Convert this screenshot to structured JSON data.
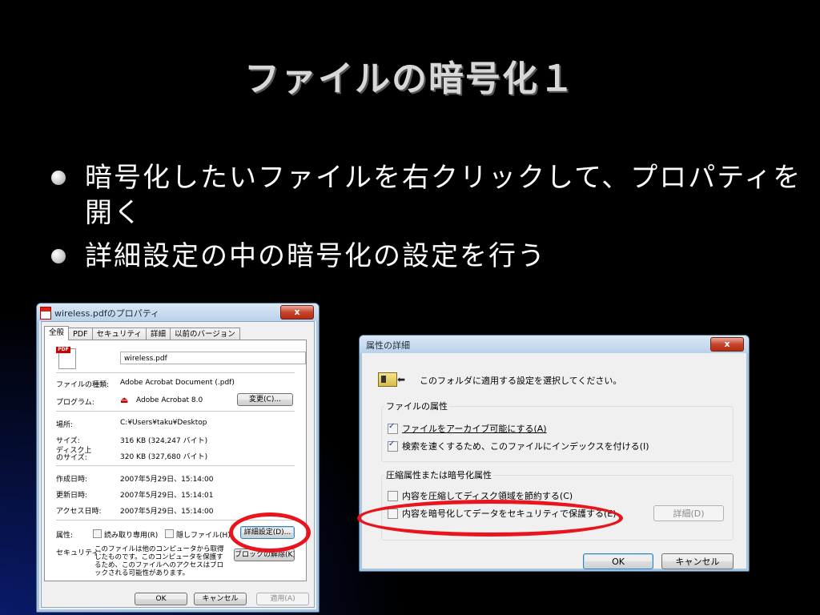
{
  "slide": {
    "title": "ファイルの暗号化１",
    "bullets": [
      "暗号化したいファイルを右クリックして、プロパティを開く",
      "詳細設定の中の暗号化の設定を行う"
    ]
  },
  "properties_window": {
    "title": "wireless.pdfのプロパティ",
    "close": "x",
    "tabs": [
      "全般",
      "PDF",
      "セキュリティ",
      "詳細",
      "以前のバージョン"
    ],
    "filename": "wireless.pdf",
    "rows": [
      {
        "label": "ファイルの種類:",
        "value": "Adobe Acrobat Document (.pdf)"
      },
      {
        "label": "プログラム:",
        "value": "Adobe Acrobat 8.0"
      },
      {
        "label": "場所:",
        "value": "C:¥Users¥taku¥Desktop"
      },
      {
        "label": "サイズ:",
        "value": "316 KB (324,247 バイト)"
      },
      {
        "label": "ディスク上\nのサイズ:",
        "value": "320 KB (327,680 バイト)"
      },
      {
        "label": "作成日時:",
        "value": "2007年5月29日、15:14:00"
      },
      {
        "label": "更新日時:",
        "value": "2007年5月29日、15:14:01"
      },
      {
        "label": "アクセス日時:",
        "value": "2007年5月29日、15:14:00"
      }
    ],
    "change_button": "変更(C)...",
    "attributes_label": "属性:",
    "readonly_label": "読み取り専用(R)",
    "hidden_label": "隠しファイル(H)",
    "advanced_button": "詳細設定(D)...",
    "security_label": "セキュリティ:",
    "security_text": "このファイルは他のコンピュータから取得したものです。このコンピュータを保護するため、このファイルへのアクセスはブロックされる可能性があります。",
    "unblock_button": "ブロックの解除(K)",
    "ok": "OK",
    "cancel": "キャンセル",
    "apply": "適用(A)"
  },
  "advanced_window": {
    "title": "属性の詳細",
    "close": "x",
    "instruction": "このフォルダに適用する設定を選択してください。",
    "file_attr_group": "ファイルの属性",
    "archive_label": "ファイルをアーカイブ可能にする(A)",
    "index_label": "検索を速くするため、このファイルにインデックスを付ける(I)",
    "compress_group": "圧縮属性または暗号化属性",
    "compress_label": "内容を圧縮してディスク領域を節約する(C)",
    "encrypt_label": "内容を暗号化してデータをセキュリティで保護する(E)",
    "details_button": "詳細(D)",
    "ok": "OK",
    "cancel": "キャンセル"
  },
  "colors": {
    "highlight_oval": "#e8141e",
    "slide_background": "#000000"
  }
}
